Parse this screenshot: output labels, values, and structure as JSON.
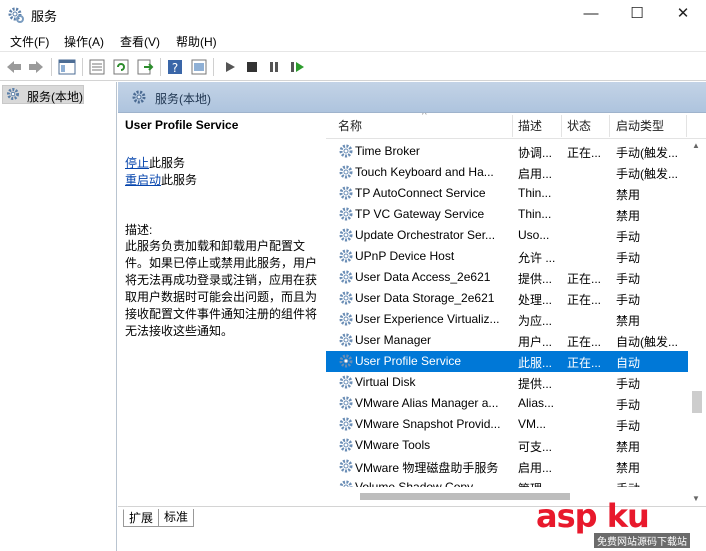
{
  "window": {
    "title": "服务",
    "minimize": "—",
    "maximize": "☐",
    "close": "✕"
  },
  "menu": [
    "文件(F)",
    "操作(A)",
    "查看(V)",
    "帮助(H)"
  ],
  "toolbar": {
    "icons": [
      "back-icon",
      "forward-icon",
      "show-tree-icon",
      "properties-icon",
      "refresh-icon",
      "export-icon",
      "help-icon",
      "console-icon",
      "start-icon",
      "stop-icon",
      "pause-icon",
      "restart-icon"
    ]
  },
  "tree": {
    "item": "服务(本地)"
  },
  "pane": {
    "header": "服务(本地)"
  },
  "detail": {
    "service_name": "User Profile Service",
    "stop_link": "停止",
    "stop_suffix": "此服务",
    "restart_link": "重启动",
    "restart_suffix": "此服务",
    "desc_label": "描述:",
    "desc_text": "此服务负责加载和卸载用户配置文件。如果已停止或禁用此服务，用户将无法再成功登录或注销，应用在获取用户数据时可能会出问题，而且为接收配置文件事件通知注册的组件将无法接收这些通知。"
  },
  "columns": {
    "name": "名称",
    "desc": "描述",
    "status": "状态",
    "startup": "启动类型"
  },
  "services": [
    {
      "name": "Time Broker",
      "desc": "协调...",
      "status": "正在...",
      "startup": "手动(触发..."
    },
    {
      "name": "Touch Keyboard and Ha...",
      "desc": "启用...",
      "status": "",
      "startup": "手动(触发..."
    },
    {
      "name": "TP AutoConnect Service",
      "desc": "Thin...",
      "status": "",
      "startup": "禁用"
    },
    {
      "name": "TP VC Gateway Service",
      "desc": "Thin...",
      "status": "",
      "startup": "禁用"
    },
    {
      "name": "Update Orchestrator Ser...",
      "desc": "Uso...",
      "status": "",
      "startup": "手动"
    },
    {
      "name": "UPnP Device Host",
      "desc": "允许 ...",
      "status": "",
      "startup": "手动"
    },
    {
      "name": "User Data Access_2e621",
      "desc": "提供...",
      "status": "正在...",
      "startup": "手动"
    },
    {
      "name": "User Data Storage_2e621",
      "desc": "处理...",
      "status": "正在...",
      "startup": "手动"
    },
    {
      "name": "User Experience Virtualiz...",
      "desc": "为应...",
      "status": "",
      "startup": "禁用"
    },
    {
      "name": "User Manager",
      "desc": "用户...",
      "status": "正在...",
      "startup": "自动(触发..."
    },
    {
      "name": "User Profile Service",
      "desc": "此服...",
      "status": "正在...",
      "startup": "自动",
      "selected": true
    },
    {
      "name": "Virtual Disk",
      "desc": "提供...",
      "status": "",
      "startup": "手动"
    },
    {
      "name": "VMware Alias Manager a...",
      "desc": "Alias...",
      "status": "",
      "startup": "手动"
    },
    {
      "name": "VMware Snapshot Provid...",
      "desc": "VM...",
      "status": "",
      "startup": "手动"
    },
    {
      "name": "VMware Tools",
      "desc": "可支...",
      "status": "",
      "startup": "禁用"
    },
    {
      "name": "VMware 物理磁盘助手服务",
      "desc": "启用...",
      "status": "",
      "startup": "禁用"
    },
    {
      "name": "Volume Shadow Copy",
      "desc": "管理...",
      "status": "",
      "startup": "手动"
    }
  ],
  "tabs": [
    "扩展",
    "标准"
  ],
  "watermark": {
    "main": "asp ku",
    "sub": "免费网站源码下载站"
  },
  "colors": {
    "selection": "#0078d7",
    "link": "#0645ad",
    "header": "#aec4de"
  }
}
